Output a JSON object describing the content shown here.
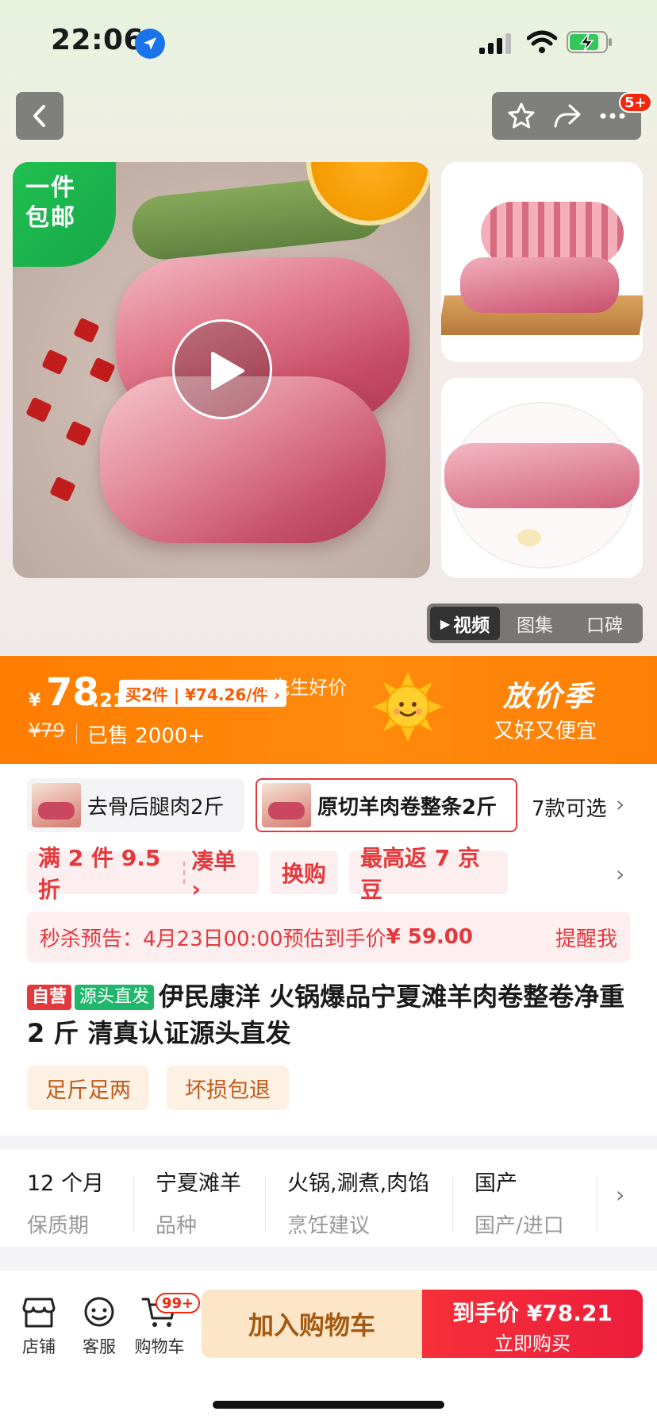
{
  "status_bar": {
    "time": "22:06"
  },
  "top_nav": {
    "cart_count_badge": "5+"
  },
  "hero": {
    "free_ship_tag": [
      "一件",
      "包邮"
    ],
    "media_tabs": [
      "视频",
      "图集",
      "口碑"
    ],
    "active_tab": "视频"
  },
  "price": {
    "currency": "¥",
    "integer": "78",
    "decimal": ".21",
    "buy2_offer": "买2件 | ¥74.26/件 ›",
    "overlay_text": "7先生好价",
    "original_price": "¥79",
    "sold": "已售 2000+",
    "promo_title": "放价季",
    "promo_sub": "又好又便宜",
    "accent": "#FF7D00"
  },
  "variants": {
    "items": [
      "去骨后腿肉2斤",
      "原切羊肉卷整条2斤"
    ],
    "selected_index": 1,
    "more": "7款可选"
  },
  "coupons": {
    "discount": "满 2 件 9.5 折",
    "bundle": "凑单 ›",
    "exchange": "换购",
    "cashback": "最高返 7 京豆"
  },
  "seckill": {
    "label": "秒杀预告：",
    "time": "4月23日00:00",
    "est": "预估到手价",
    "amount": "¥ 59.00",
    "remind": "提醒我"
  },
  "product": {
    "tag_self": "自营",
    "tag_direct": "源头直发",
    "title": "伊民康洋 火锅爆品宁夏滩羊肉卷整卷净重 2 斤 清真认证源头直发"
  },
  "services": [
    "足斤足两",
    "坏损包退"
  ],
  "specs": [
    {
      "value": "12 个月",
      "key": "保质期"
    },
    {
      "value": "宁夏滩羊",
      "key": "品种"
    },
    {
      "value": "火锅,涮煮,肉馅",
      "key": "烹饪建议"
    },
    {
      "value": "国产",
      "key": "国产/进口"
    }
  ],
  "bottom_bar": {
    "store": "店铺",
    "service": "客服",
    "cart": "购物车",
    "cart_badge": "99+",
    "add_to_cart": "加入购物车",
    "final_price_label": "到手价",
    "final_price": "¥78.21",
    "buy_now": "立即购买",
    "buy_color": "#F2303A"
  }
}
